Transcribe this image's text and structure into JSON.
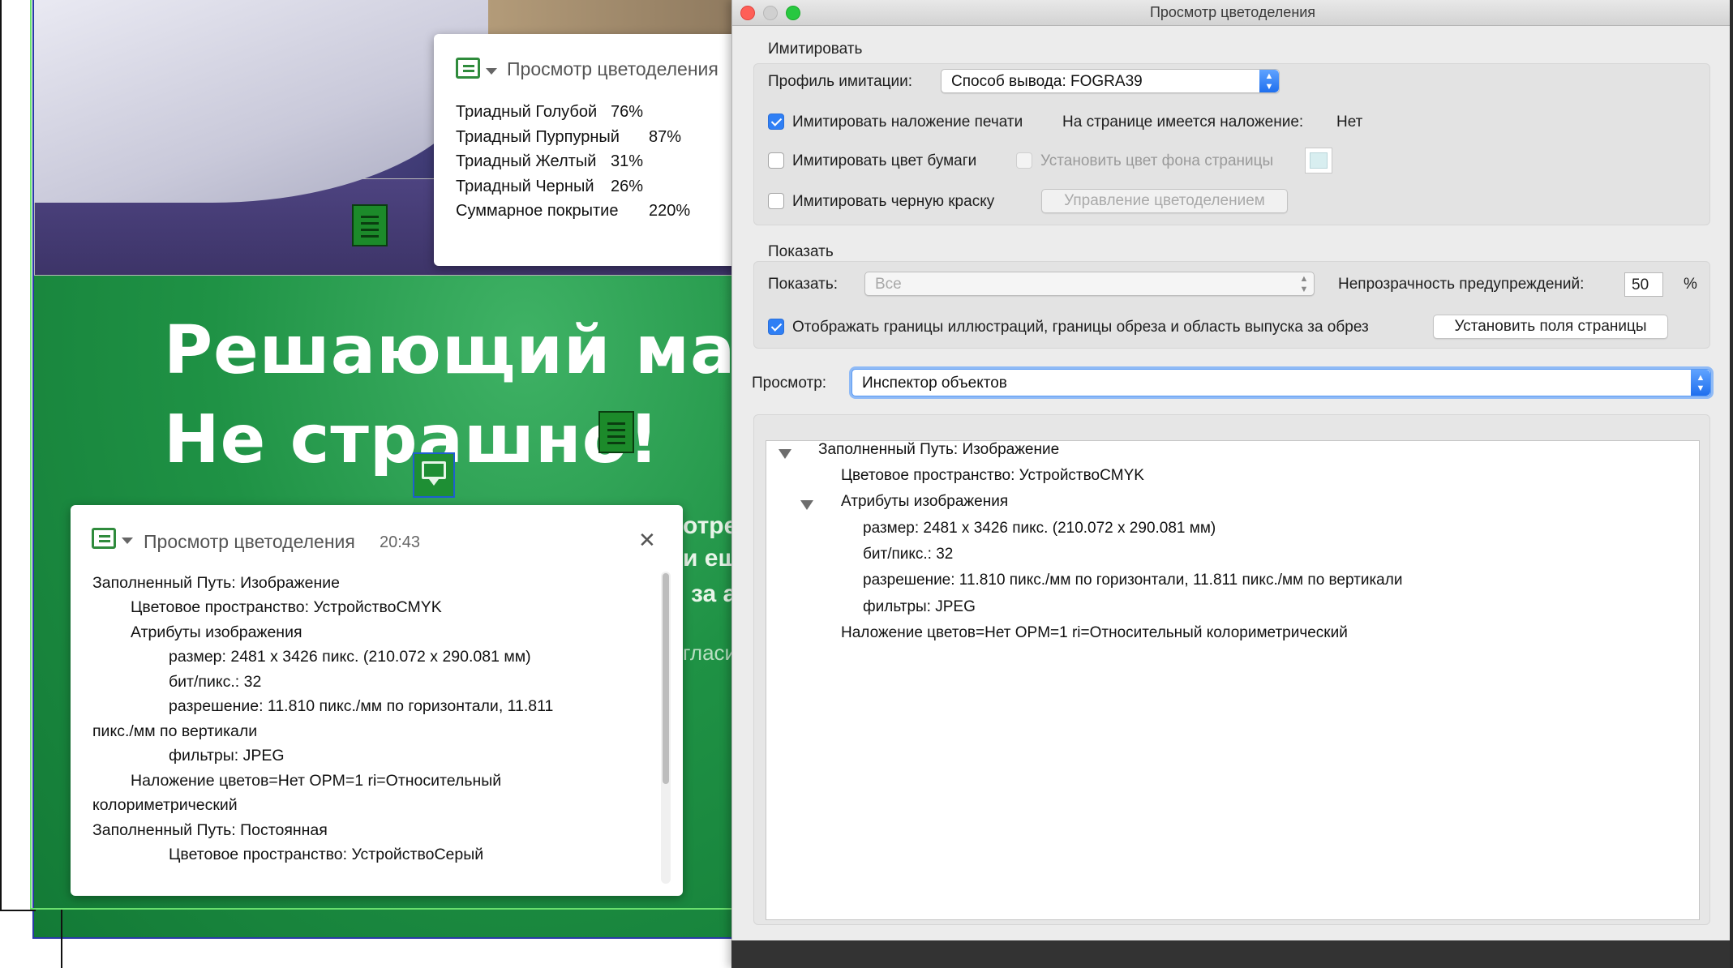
{
  "doc": {
    "headline": [
      "Решающий матч,",
      "Не страшно!"
    ],
    "behind_lines": [
      "отре",
      "и ещ",
      "за а",
      "гласи"
    ]
  },
  "tooltip": {
    "title": "Просмотр цветоделения",
    "rows": [
      {
        "name": "Триадный Голубой",
        "value": "76%"
      },
      {
        "name": "Триадный Пурпурный",
        "value": "87%"
      },
      {
        "name": "Триадный Желтый",
        "value": "31%"
      },
      {
        "name": "Триадный Черный",
        "value": "26%"
      },
      {
        "name": "Суммарное покрытие",
        "value": "220%"
      }
    ]
  },
  "comment": {
    "title": "Просмотр цветоделения",
    "time": "20:43",
    "close": "✕",
    "lines": [
      "Заполненный Путь: Изображение",
      "Цветовое пространство: УстройствоCMYK",
      "Атрибуты изображения",
      "размер: 2481 x 3426 пикс. (210.072 x 290.081 мм)",
      "бит/пикс.: 32",
      "разрешение: 11.810 пикс./мм по горизонтали, 11.811",
      "пикс./мм по вертикали",
      "фильтры: JPEG",
      "Наложение цветов=Нет OPM=1 ri=Относительный",
      "колориметрический",
      "Заполненный Путь: Постоянная",
      "Цветовое пространство: УстройствоСерый"
    ]
  },
  "dialog": {
    "title": "Просмотр цветоделения",
    "simulate": {
      "section": "Имитировать",
      "profile_label": "Профиль имитации:",
      "profile_value": "Способ вывода: FOGRA39",
      "overprint_label": "Имитировать наложение печати",
      "overprint_checked": true,
      "page_overprint_label": "На странице имеется наложение:",
      "page_overprint_value": "Нет",
      "paper_label": "Имитировать цвет бумаги",
      "paper_checked": false,
      "bg_label": "Установить цвет фона страницы",
      "bg_swatch": "#d8eef0",
      "black_label": "Имитировать черную краску",
      "black_checked": false,
      "manage_button": "Управление цветоделением"
    },
    "show": {
      "section": "Показать",
      "show_label": "Показать:",
      "show_value": "Все",
      "opacity_label": "Непрозрачность предупреждений:",
      "opacity_value": "50",
      "opacity_unit": "%",
      "bounds_label": "Отображать границы иллюстраций, границы обреза и область выпуска за обрез",
      "bounds_checked": true,
      "page_fields_button": "Установить поля страницы"
    },
    "preview": {
      "label": "Просмотр:",
      "value": "Инспектор объектов"
    },
    "tree": [
      "Заполненный Путь: Изображение",
      "Цветовое пространство: УстройствоCMYK",
      "Атрибуты изображения",
      "размер: 2481 x 3426 пикс. (210.072 x 290.081 мм)",
      "бит/пикс.: 32",
      "разрешение: 11.810 пикс./мм по горизонтали, 11.811 пикс./мм по вертикали",
      "фильтры: JPEG",
      "Наложение цветов=Нет OPM=1 ri=Относительный колориметрический"
    ]
  }
}
